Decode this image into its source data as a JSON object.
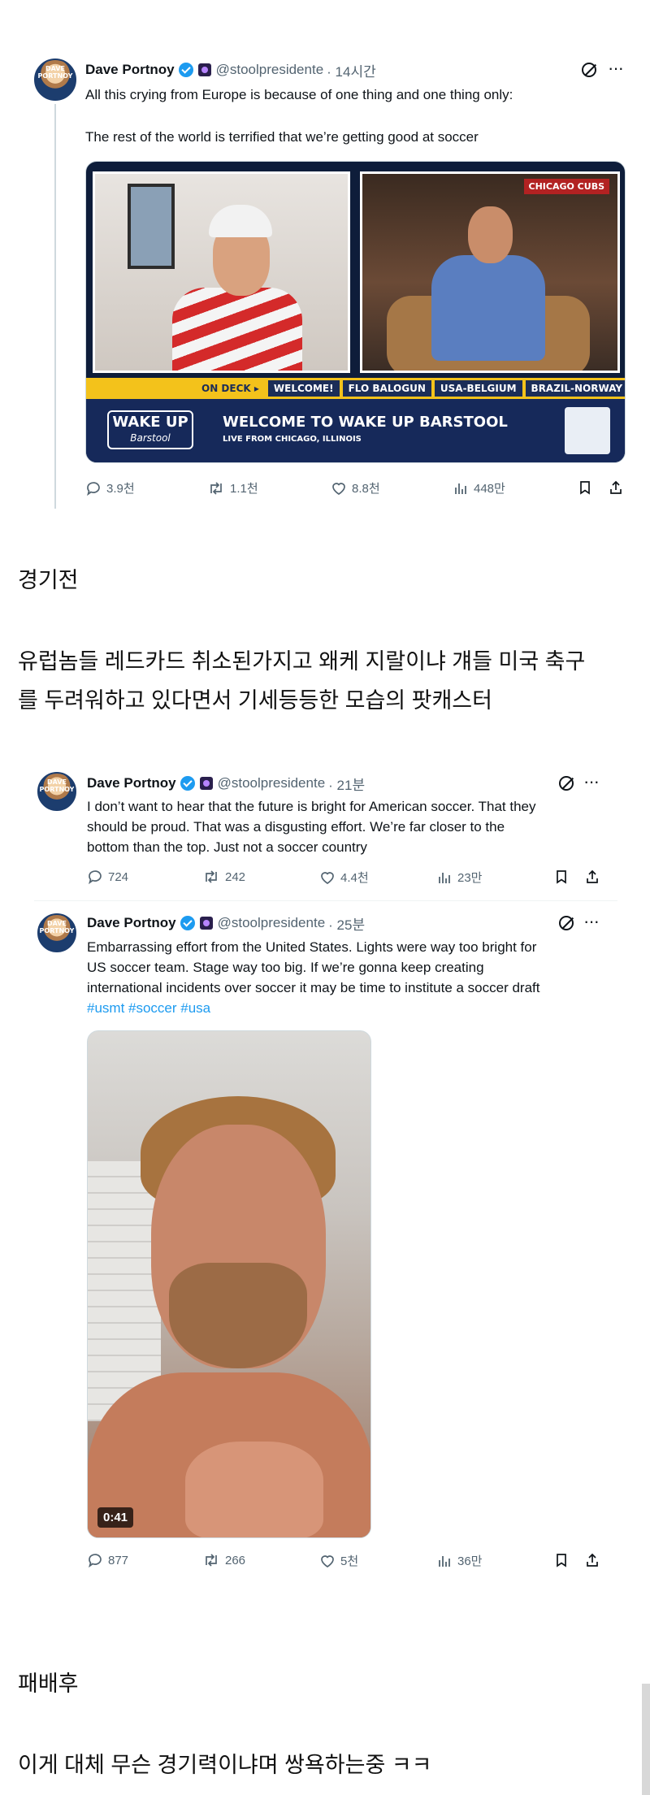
{
  "tweet1": {
    "name": "Dave Portnoy",
    "avatar_text": "DAVE PORTNOY",
    "handle": "@stoolpresidente",
    "time": "· 14시간",
    "text_line1": "All this crying from Europe is because of one thing and one thing only:",
    "text_line2": "The rest of the world is terrified that we’re getting good at soccer",
    "media": {
      "cubs_sign": "CHICAGO CUBS",
      "ticker_ondeck": "ON DECK ▸",
      "ticker_items": [
        "WELCOME!",
        "FLO BALOGUN",
        "USA-BELGIUM",
        "BRAZIL-NORWAY"
      ],
      "logo_main": "WAKE UP",
      "logo_sub": "Barstool",
      "banner_title": "WELCOME TO WAKE UP BARSTOOL",
      "banner_sub": "LIVE FROM CHICAGO, ILLINOIS"
    },
    "replies": "3.9천",
    "reposts": "1.1천",
    "likes": "8.8천",
    "views": "448만"
  },
  "caption1": "경기전",
  "caption2_line1": "유럽놈들 레드카드 취소된가지고 왜케 지랄이냐 걔들 미국 축구",
  "caption2_line2": "를 두려워하고 있다면서 기세등등한 모습의 팟캐스터",
  "tweet2": {
    "name": "Dave Portnoy",
    "avatar_text": "DAVE PORTNOY",
    "handle": "@stoolpresidente",
    "time": "· 21분",
    "text_line1": "I don’t want to hear that the future is bright for American soccer.  That they",
    "text_line2": "should be proud.  That was a disgusting effort.  We’re far closer to the",
    "text_line3": "bottom than the top.  Just not a soccer country",
    "replies": "724",
    "reposts": "242",
    "likes": "4.4천",
    "views": "23만"
  },
  "tweet3": {
    "name": "Dave Portnoy",
    "avatar_text": "DAVE PORTNOY",
    "handle": "@stoolpresidente",
    "time": "· 25분",
    "text_line1": "Embarrassing effort from the United States. Lights were way too bright for",
    "text_line2": "US soccer team. Stage way too big.    If we’re gonna keep creating",
    "text_line3": "international incidents over soccer it may be time to institute a soccer draft",
    "hashtags": "#usmt #soccer #usa",
    "video_duration": "0:41",
    "replies": "877",
    "reposts": "266",
    "likes": "5천",
    "views": "36만"
  },
  "caption3": "패배후",
  "caption4": "이게 대체 무슨 경기력이냐며 쌍욕하는중 ㅋㅋ",
  "icons": {
    "reply": "reply-icon",
    "repost": "repost-icon",
    "like": "heart-icon",
    "views": "views-icon",
    "bookmark": "bookmark-icon",
    "share": "share-icon",
    "grok": "grok-icon",
    "more": "more-icon"
  },
  "colors": {
    "verified": "#1d9bf0",
    "hashtag": "#1d9bf0",
    "secondary_text": "#536471"
  }
}
